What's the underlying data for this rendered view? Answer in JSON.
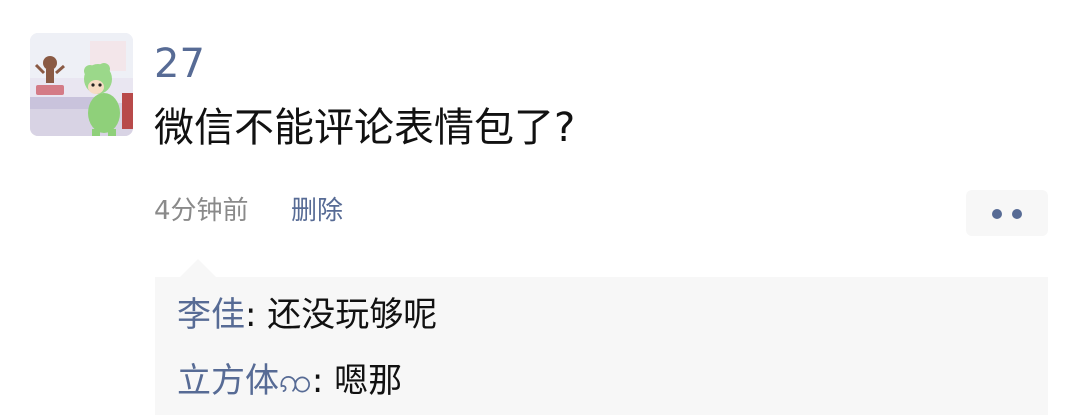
{
  "post": {
    "username": "27",
    "text": "微信不能评论表情包了?",
    "time": "4分钟前",
    "delete_label": "删除",
    "more_icon": "more-dots-icon"
  },
  "comments": [
    {
      "author": "李佳",
      "separator": ": ",
      "text": "还没玩够呢"
    },
    {
      "author": "立方体",
      "author_emoji": "ꩡ",
      "separator": ": ",
      "text": "嗯那"
    }
  ],
  "colors": {
    "link": "#576b95",
    "text": "#111111",
    "meta": "#8a8a8a",
    "comment_bg": "#f7f7f7"
  }
}
